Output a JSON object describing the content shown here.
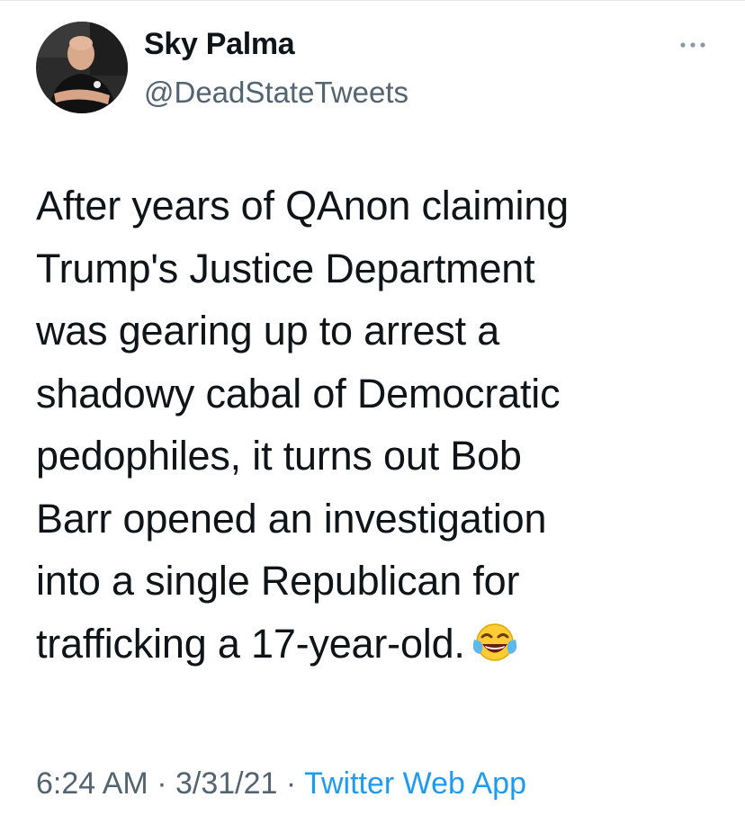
{
  "tweet": {
    "author_name": "Sky Palma",
    "author_handle": "@DeadStateTweets",
    "text_lines": [
      "After years of QAnon claiming",
      "Trump's Justice Department",
      "was gearing up to arrest a",
      "shadowy cabal of Democratic",
      "pedophiles, it turns out Bob",
      "Barr opened an investigation",
      "into a single Republican for",
      "trafficking a 17-year-old."
    ],
    "emoji": "face-with-tears-of-joy",
    "time": "6:24 AM",
    "date": "3/31/21",
    "separator": "·",
    "source": "Twitter Web App"
  },
  "icons": {
    "more": "more-options-icon",
    "avatar": "profile-photo"
  },
  "colors": {
    "text": "#0f1419",
    "secondary": "#536471",
    "link": "#1d9bf0"
  }
}
